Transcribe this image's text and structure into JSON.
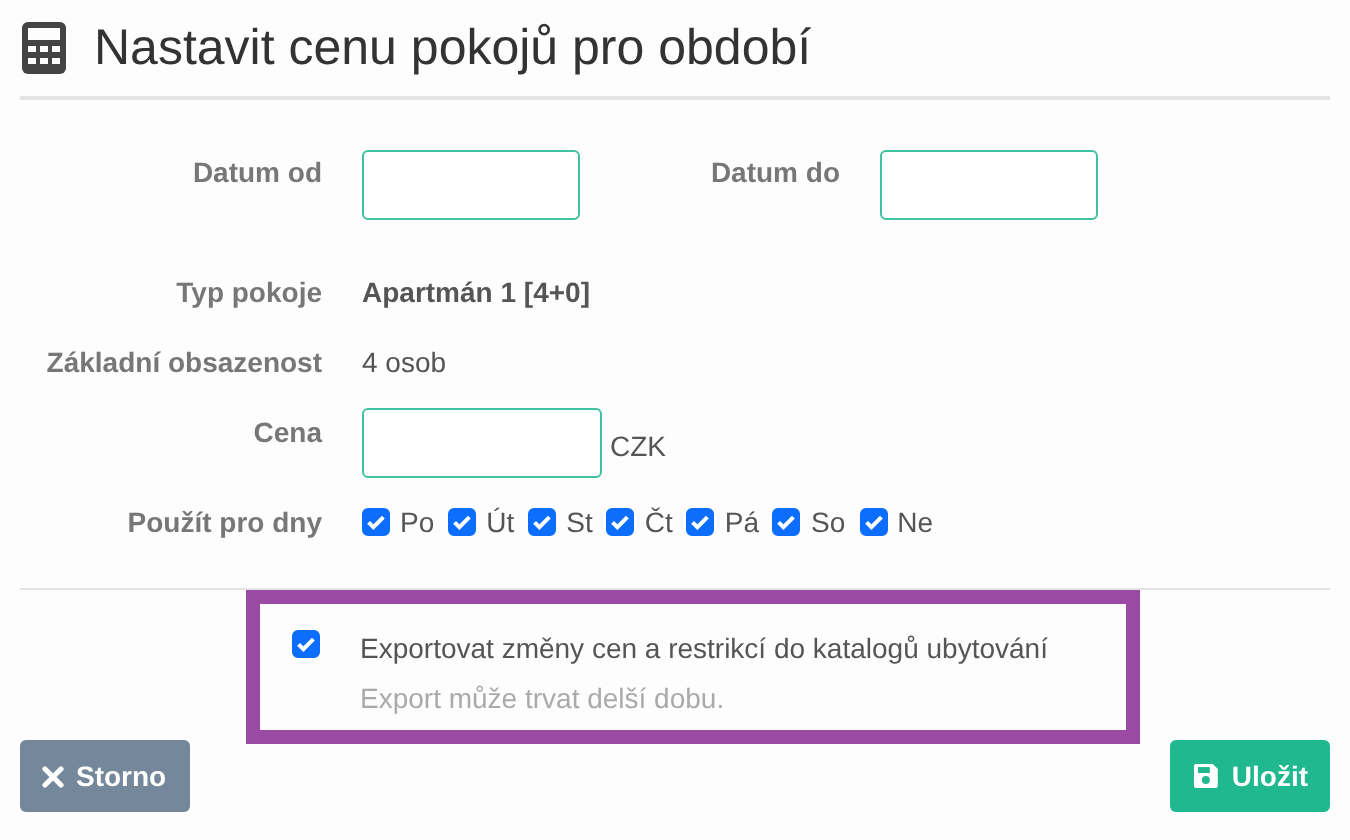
{
  "dialog": {
    "title": "Nastavit cenu pokojů pro období"
  },
  "form": {
    "date_from": {
      "label": "Datum od"
    },
    "date_to": {
      "label": "Datum do"
    },
    "room_type": {
      "label": "Typ pokoje",
      "value": "Apartmán 1 [4+0]"
    },
    "occupancy": {
      "label": "Základní obsazenost",
      "value": "4 osob"
    },
    "price": {
      "label": "Cena",
      "unit": "CZK"
    },
    "days": {
      "label": "Použít pro dny",
      "items": [
        {
          "label": "Po",
          "checked": true
        },
        {
          "label": "Út",
          "checked": true
        },
        {
          "label": "St",
          "checked": true
        },
        {
          "label": "Čt",
          "checked": true
        },
        {
          "label": "Pá",
          "checked": true
        },
        {
          "label": "So",
          "checked": true
        },
        {
          "label": "Ne",
          "checked": true
        }
      ]
    }
  },
  "export": {
    "checked": true,
    "label": "Exportovat změny cen a restrikcí do katalogů ubytování",
    "hint": "Export může trvat delší dobu."
  },
  "buttons": [
    {
      "label": "Storno",
      "kind": "cancel"
    },
    {
      "label": "Uložit",
      "kind": "save"
    }
  ]
}
